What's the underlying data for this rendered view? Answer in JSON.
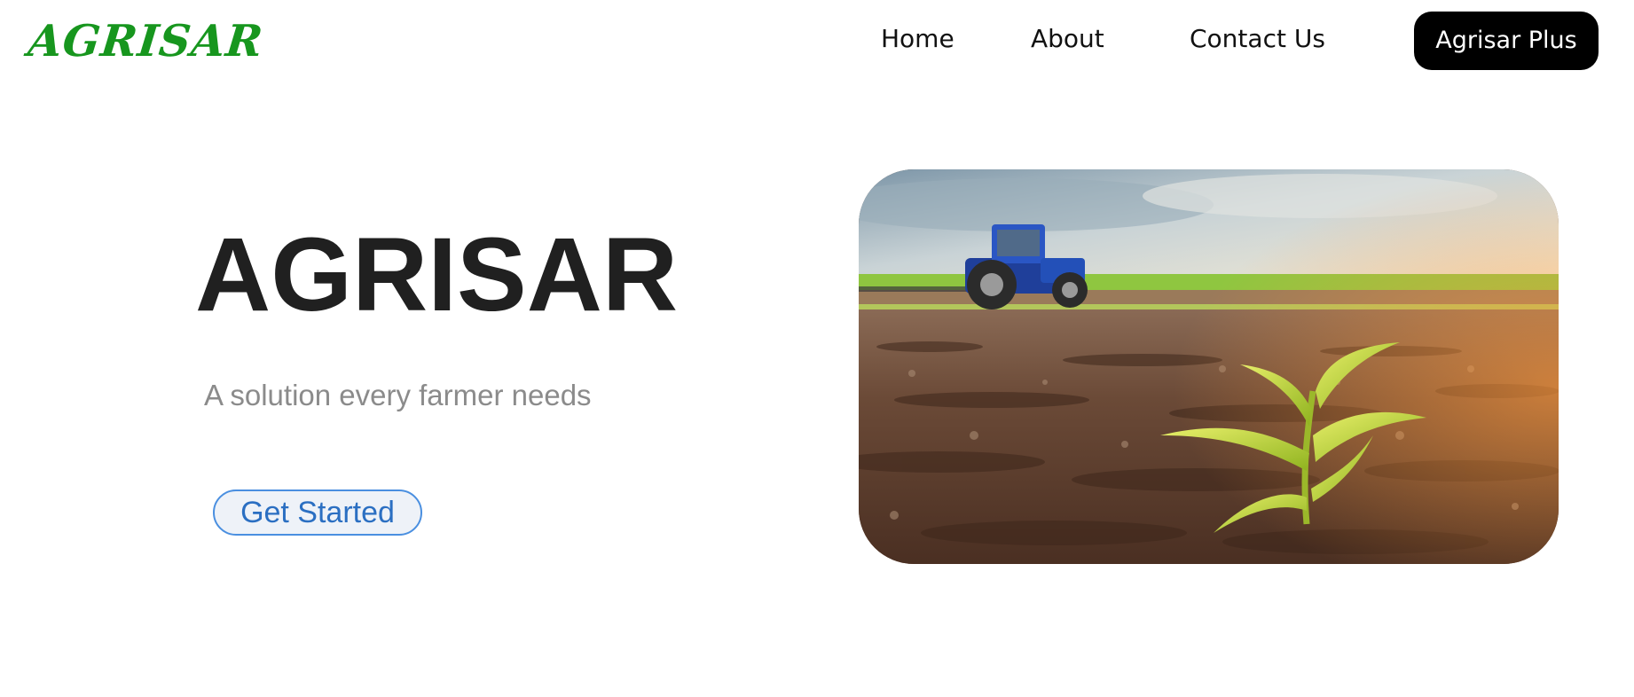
{
  "header": {
    "logo": "AGRISAR",
    "nav": {
      "home": "Home",
      "about": "About",
      "contact": "Contact Us",
      "plus": "Agrisar Plus"
    }
  },
  "hero": {
    "title": "AGRISAR",
    "subtitle": "A solution every farmer needs",
    "cta_label": "Get Started",
    "image": "tractor in field with corn seedling in foreground"
  },
  "colors": {
    "brand_green": "#17961e",
    "button_dark": "#000000",
    "cta_blue": "#2b6fc2"
  }
}
